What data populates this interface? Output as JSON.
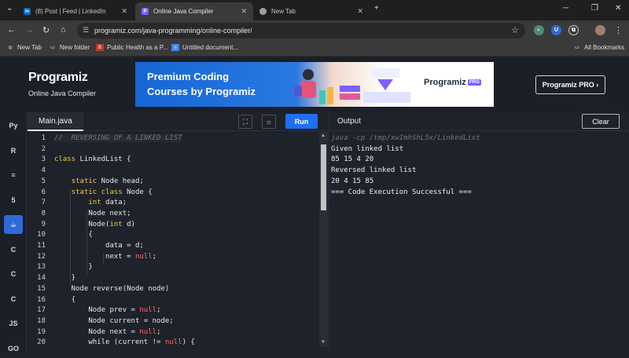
{
  "browser": {
    "tabs": [
      {
        "label": "(8) Post | Feed | LinkedIn",
        "icon": "linkedin-icon",
        "color": "#0a66c2"
      },
      {
        "label": "Online Java Compiler",
        "icon": "programiz-icon",
        "color": "#7b61ff"
      },
      {
        "label": "New Tab",
        "icon": "chrome-icon",
        "color": "#9aa0a6"
      }
    ],
    "url": "programiz.com/java-programming/online-compiler/",
    "bookmarks": [
      "New Tab",
      "New folder",
      "Public Health as a P...",
      "Untitled document..."
    ],
    "all_bookmarks": "All Bookmarks"
  },
  "site": {
    "logo": "Programiz",
    "subtitle": "Online Java Compiler",
    "banner_line1": "Premium Coding",
    "banner_line2": "Courses by Programiz",
    "banner_brand": "Programiz",
    "banner_badge": "PRO",
    "pro_button": "Programiz PRO ›"
  },
  "rail": {
    "items": [
      {
        "name": "python-icon",
        "glyph": "Py"
      },
      {
        "name": "r-icon",
        "glyph": "R"
      },
      {
        "name": "sql-icon",
        "glyph": "≡"
      },
      {
        "name": "html5-icon",
        "glyph": "5"
      },
      {
        "name": "java-icon",
        "glyph": "☕"
      },
      {
        "name": "c-icon",
        "glyph": "C"
      },
      {
        "name": "cpp-icon",
        "glyph": "C"
      },
      {
        "name": "csharp-icon",
        "glyph": "C"
      },
      {
        "name": "javascript-icon",
        "glyph": "JS"
      },
      {
        "name": "go-icon",
        "glyph": "GO"
      }
    ]
  },
  "editor": {
    "filename": "Main.java",
    "run_label": "Run",
    "lines": [
      {
        "n": "1",
        "code": "//  REVERSING OF A LINKED LIST"
      },
      {
        "n": "2",
        "code": ""
      },
      {
        "n": "3",
        "code": "class LinkedList {"
      },
      {
        "n": "4",
        "code": ""
      },
      {
        "n": "5",
        "code": "    static Node head;"
      },
      {
        "n": "6",
        "code": "    static class Node {"
      },
      {
        "n": "7",
        "code": "        int data;"
      },
      {
        "n": "8",
        "code": "        Node next;"
      },
      {
        "n": "9",
        "code": "        Node(int d)"
      },
      {
        "n": "10",
        "code": "        {"
      },
      {
        "n": "11",
        "code": "            data = d;"
      },
      {
        "n": "12",
        "code": "            next = null;"
      },
      {
        "n": "13",
        "code": "        }"
      },
      {
        "n": "14",
        "code": "    }"
      },
      {
        "n": "15",
        "code": "    Node reverse(Node node)"
      },
      {
        "n": "16",
        "code": "    {"
      },
      {
        "n": "17",
        "code": "        Node prev = null;"
      },
      {
        "n": "18",
        "code": "        Node current = node;"
      },
      {
        "n": "19",
        "code": "        Node next = null;"
      },
      {
        "n": "20",
        "code": "        while (current != null) {"
      }
    ]
  },
  "output": {
    "title": "Output",
    "clear_label": "Clear",
    "lines": [
      "java -cp /tmp/xwImhShL5x/LinkedList",
      "Given linked list",
      "85 15 4 20",
      "Reversed linked list",
      "20 4 15 85",
      "=== Code Execution Successful ==="
    ]
  }
}
